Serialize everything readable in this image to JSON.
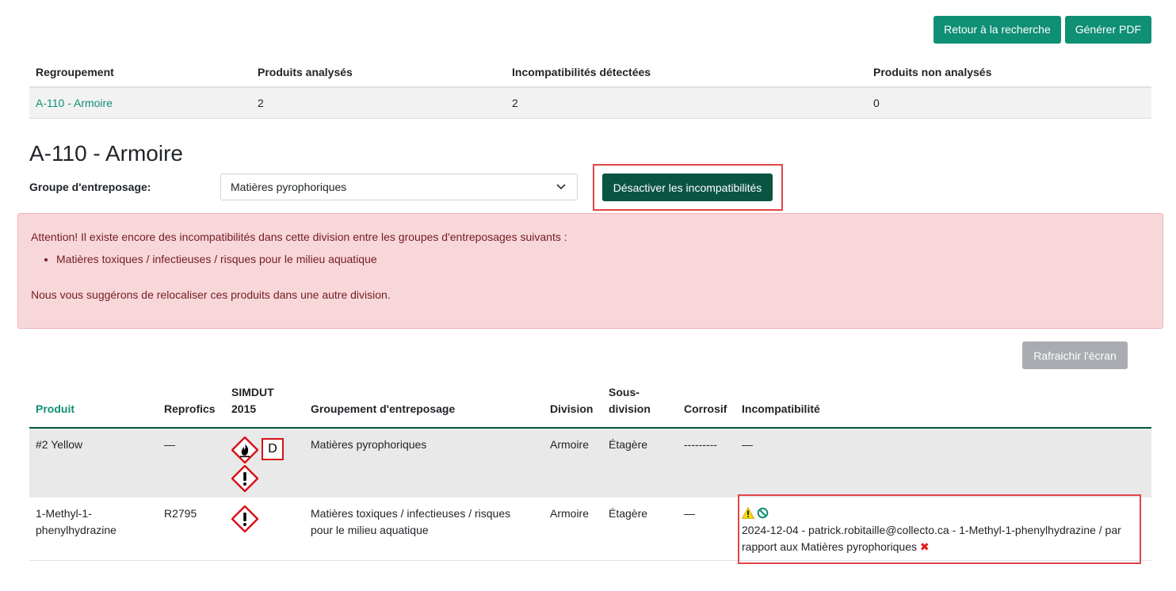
{
  "header": {
    "back_button": "Retour à la recherche",
    "pdf_button": "Générer PDF"
  },
  "summary": {
    "columns": [
      "Regroupement",
      "Produits analysés",
      "Incompatibilités détectées",
      "Produits non analysés"
    ],
    "row": {
      "regroupement": "A-110 - Armoire",
      "produits_analyses": "2",
      "incompatibilites": "2",
      "non_analyses": "0"
    }
  },
  "division_title": "A-110 - Armoire",
  "group": {
    "label": "Groupe d'entreposage:",
    "selected": "Matières pyrophoriques",
    "disable_button": "Désactiver les incompatibilités"
  },
  "alert": {
    "intro": "Attention! Il existe encore des incompatibilités dans cette division entre les groupes d'entreposages suivants :",
    "items": [
      "Matières toxiques / infectieuses / risques pour le milieu aquatique"
    ],
    "suggestion": "Nous vous suggérons de relocaliser ces produits dans une autre division."
  },
  "refresh_button": "Rafraichir l'écran",
  "table": {
    "headers": {
      "produit": "Produit",
      "reprofics": "Reprofics",
      "simdut_1": "SIMDUT",
      "simdut_2": "2015",
      "groupement": "Groupement d'entreposage",
      "division": "Division",
      "sous_1": "Sous-",
      "sous_2": "division",
      "corrosif": "Corrosif",
      "incompat": "Incompatibilité"
    },
    "rows": [
      {
        "produit": "#2 Yellow",
        "reprofics": "—",
        "pictograms": [
          "flame-pictogram",
          "D",
          "exclamation-pictogram"
        ],
        "d_label": "D",
        "groupement": "Matières pyrophoriques",
        "division": "Armoire",
        "sous_division": "Étagère",
        "corrosif": "---------",
        "incompat": "—"
      },
      {
        "produit_1": "1-Methyl-1-",
        "produit_2": "phenylhydrazine",
        "reprofics": "R2795",
        "pictograms": [
          "exclamation-pictogram"
        ],
        "groupement_1": "Matières toxiques / infectieuses / risques",
        "groupement_2": "pour le milieu aquatique",
        "division": "Armoire",
        "sous_division": "Étagère",
        "corrosif": "—",
        "incompat_1": "2024-12-04 - patrick.robitaille@collecto.ca - 1-Methyl-1-phenylhydrazine / par",
        "incompat_2": "rapport aux Matières pyrophoriques"
      }
    ]
  },
  "colors": {
    "accent": "#0f8f74",
    "dark_accent": "#0a5444",
    "alert_bg": "#f8d7da",
    "alert_text": "#721c24",
    "highlight": "#e2454b",
    "pictogram_red": "#d8111a",
    "warning_yellow": "#f5d90a"
  }
}
